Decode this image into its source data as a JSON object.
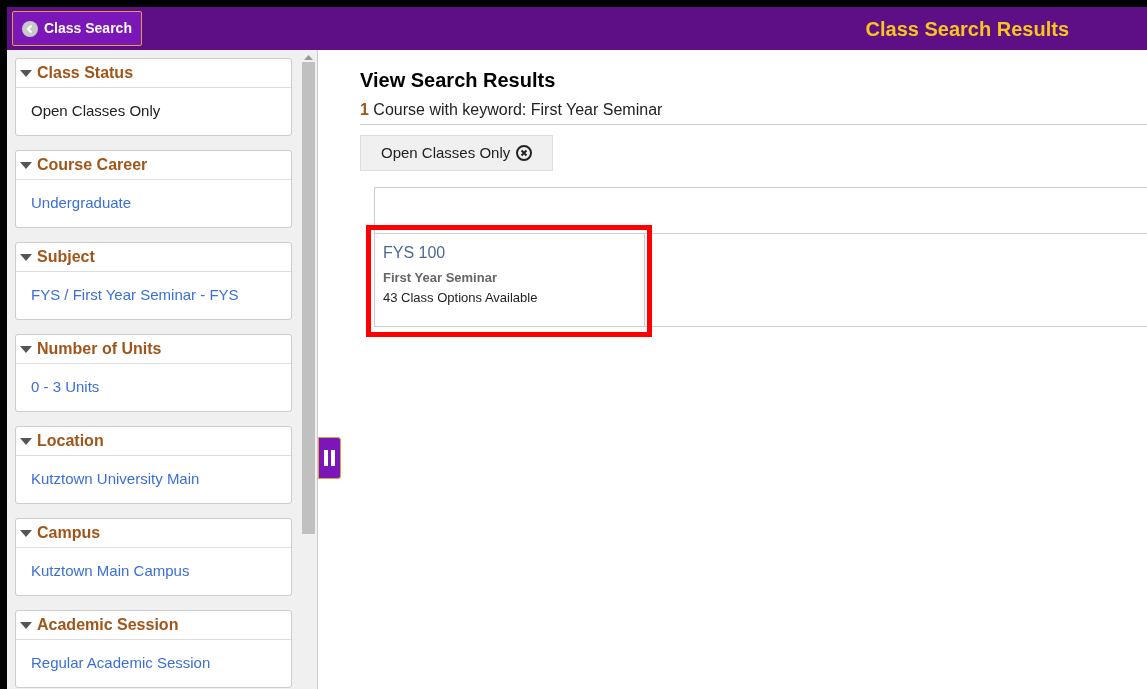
{
  "header": {
    "back_button": "Class Search",
    "title": "Class Search Results"
  },
  "filters": [
    {
      "heading": "Class Status",
      "expanded": true,
      "value": "Open Classes Only",
      "kind": "text"
    },
    {
      "heading": "Course Career",
      "expanded": true,
      "value": "Undergraduate",
      "kind": "link"
    },
    {
      "heading": "Subject",
      "expanded": true,
      "value": "FYS / First Year Seminar - FYS",
      "kind": "link"
    },
    {
      "heading": "Number of Units",
      "expanded": true,
      "value": "0 - 3 Units",
      "kind": "link"
    },
    {
      "heading": "Location",
      "expanded": true,
      "value": "Kutztown University Main",
      "kind": "link"
    },
    {
      "heading": "Campus",
      "expanded": true,
      "value": "Kutztown Main Campus",
      "kind": "link"
    },
    {
      "heading": "Academic Session",
      "expanded": true,
      "value": "Regular Academic Session",
      "kind": "link"
    }
  ],
  "results": {
    "heading": "View Search Results",
    "count": "1",
    "summary": "Course with keyword: First Year Seminar",
    "chips": [
      "Open Classes Only"
    ],
    "courses": [
      {
        "code": "FYS 100",
        "title": "First Year Seminar",
        "options": "43 Class Options Available",
        "highlighted": true
      }
    ]
  }
}
